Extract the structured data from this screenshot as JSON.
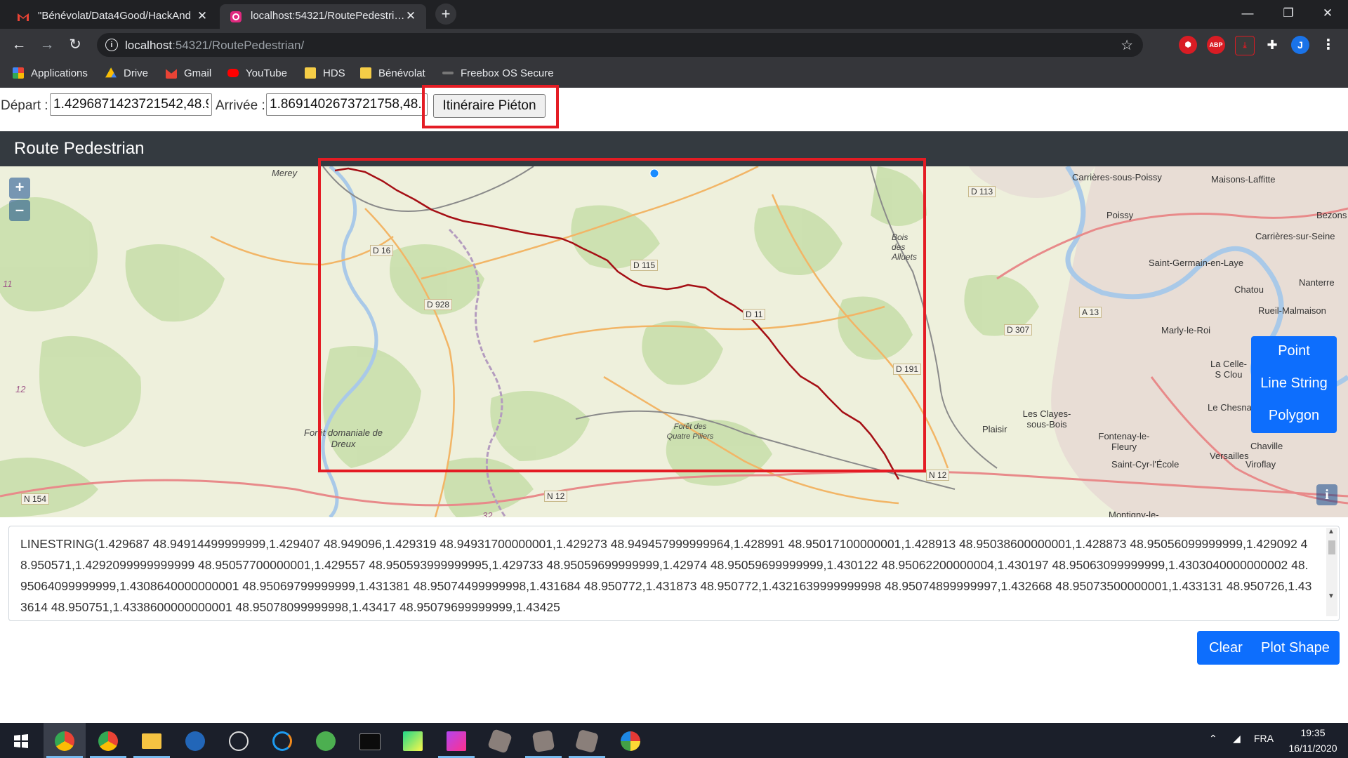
{
  "browser": {
    "tabs": [
      {
        "title": "\"Bénévolat/Data4Good/HackAnd",
        "icon": "gmail-icon",
        "active": false
      },
      {
        "title": "localhost:54321/RoutePedestrian",
        "icon": "app-icon",
        "active": true
      }
    ],
    "url_host": "localhost",
    "url_rest": ":54321/RoutePedestrian/",
    "bookmarks": [
      "Applications",
      "Drive",
      "Gmail",
      "YouTube",
      "HDS",
      "Bénévolat",
      "Freebox OS Secure"
    ],
    "extensions": [
      "ABP"
    ],
    "profile_initial": "J"
  },
  "form": {
    "depart_label": "Départ :",
    "depart_value": "1.4296871423721542,48.9",
    "arrivee_label": "Arrivée :",
    "arrivee_value": "1.8691402673721758,48.",
    "button_label": "Itinéraire Piéton"
  },
  "navbar": {
    "brand": "Route Pedestrian"
  },
  "map": {
    "zoom_in": "+",
    "zoom_out": "–",
    "info": "i",
    "route_color": "#a50f15",
    "highlight_color": "#e41c24",
    "place_labels": [
      "Merey",
      "Carrières-sous-Poissy",
      "Maisons-Laffitte",
      "Poissy",
      "Bezons",
      "Carrières-sur-Seine",
      "Saint-Germain-en-Laye",
      "Nanterre",
      "Chatou",
      "Rueil-Malmaison",
      "Marly-le-Roi",
      "Bois des Alluets",
      "La Celle-S Clou",
      "Le Chesna",
      "Les Clayes-sous-Bois",
      "Plaisir",
      "Fontenay-le-Fleury",
      "Versailles",
      "Chaville",
      "Saint-Cyr-l'École",
      "Viroflay",
      "Forêt domaniale de Dreux",
      "Forêt des Quatre Piliers",
      "Montigny-le-"
    ],
    "road_labels": [
      "D 16",
      "D 928",
      "D 113",
      "D 115",
      "D 11",
      "D 191",
      "D 307",
      "A 13",
      "N 12",
      "N 12",
      "N 154"
    ],
    "edge_numbers": [
      "11",
      "12",
      "32"
    ]
  },
  "shape_options": [
    "Point",
    "Line String",
    "Polygon"
  ],
  "wkt_text": "LINESTRING(1.429687 48.94914499999999,1.429407 48.949096,1.429319 48.94931700000001,1.429273 48.949457999999964,1.428991 48.95017100000001,1.428913 48.95038600000001,1.428873 48.95056099999999,1.429092 48.950571,1.4292099999999999 48.95057700000001,1.429557 48.950593999999995,1.429733 48.95059699999999,1.42974 48.95059699999999,1.430122 48.95062200000004,1.430197 48.95063099999999,1.4303040000000002 48.95064099999999,1.4308640000000001 48.95069799999999,1.431381 48.95074499999998,1.431684 48.950772,1.431873 48.950772,1.4321639999999998 48.95074899999997,1.432668 48.95073500000001,1.433131 48.950726,1.433614 48.950751,1.4338600000000001 48.95078099999998,1.43417 48.95079699999999,1.43425",
  "actions": {
    "clear": "Clear",
    "plot": "Plot Shape"
  },
  "taskbar": {
    "apps": [
      "windows-start",
      "chrome",
      "chrome-alt",
      "file-explorer",
      "r",
      "obs",
      "sync",
      "atom",
      "terminal",
      "pycharm",
      "phpstorm",
      "box-1",
      "box-2",
      "box-3",
      "paint"
    ],
    "lang": "FRA",
    "time": "19:35",
    "date": "16/11/2020"
  }
}
